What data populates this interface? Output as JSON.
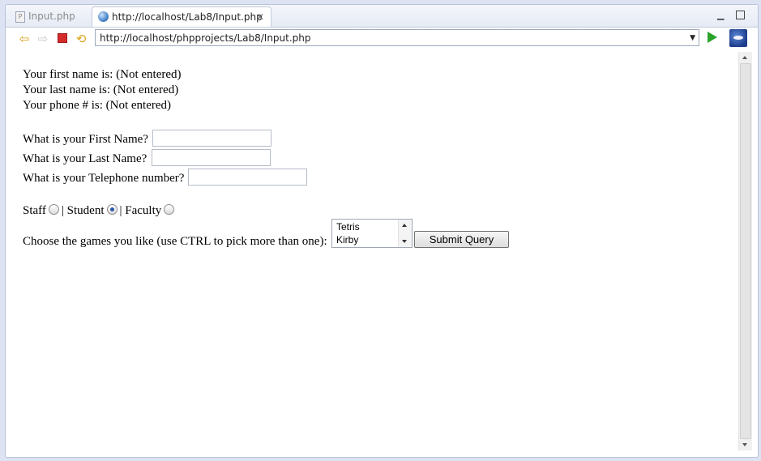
{
  "tabs": [
    {
      "label": "Input.php",
      "icon": "php-file-icon",
      "active": false
    },
    {
      "label": "http://localhost/Lab8/Input.php",
      "icon": "globe-icon",
      "active": true
    }
  ],
  "toolbar": {
    "url": "http://localhost/phpprojects/Lab8/Input.php"
  },
  "page": {
    "status_first": "Your first name is: (Not entered)",
    "status_last": "Your last name is: (Not entered)",
    "status_phone": "Your phone # is: (Not entered)",
    "first_label": "What is your First Name?",
    "last_label": "What is your Last Name?",
    "phone_label": "What is your Telephone number?",
    "radios": [
      {
        "label": "Staff",
        "checked": false
      },
      {
        "label": "Student",
        "checked": true
      },
      {
        "label": "Faculty",
        "checked": false
      }
    ],
    "separator": "|",
    "games_label": "Choose the games you like (use CTRL to pick more than one):",
    "games_options": [
      "Tetris",
      "Kirby"
    ],
    "submit_label": "Submit Query"
  }
}
